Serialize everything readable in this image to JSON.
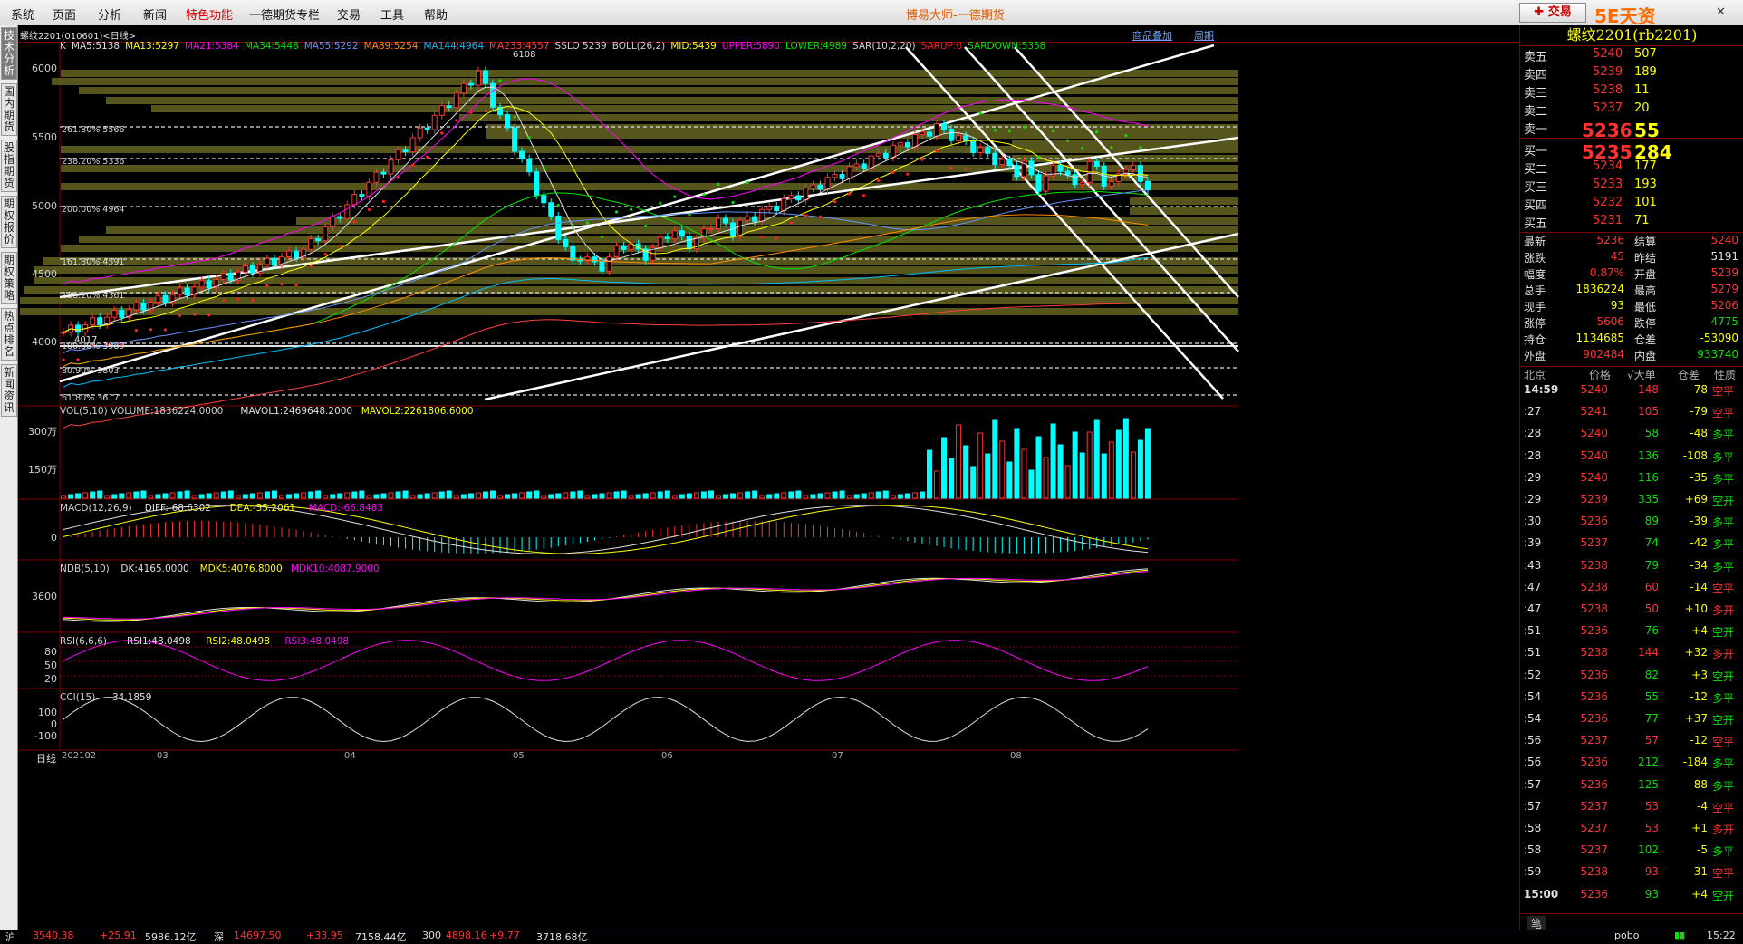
{
  "menu": {
    "items": [
      "系统",
      "页面",
      "分析",
      "新闻",
      "特色功能",
      "一德期货专栏",
      "交易",
      "工具",
      "帮助"
    ],
    "highlight": "特色功能",
    "app_title": "博易大师-一德期货",
    "trade_button": "交易",
    "watermark": "5E天资5etz.com"
  },
  "left_tabs": [
    "技术分析",
    "国内期货",
    "股指期货",
    "期权报价",
    "期权策略",
    "热点排名",
    "新闻资讯"
  ],
  "chart": {
    "header": {
      "symbol": "螺纹2201(010601)<日线>",
      "overlay_link": "商品叠加",
      "period_link": "周期"
    },
    "main_indicators": [
      {
        "text": "K",
        "color": "#d0d0d0"
      },
      {
        "text": "MA5:5138",
        "color": "#e0e0e0"
      },
      {
        "text": "MA13:5297",
        "color": "#ffff00"
      },
      {
        "text": "MA21:5384",
        "color": "#ff00ff"
      },
      {
        "text": "MA34:5448",
        "color": "#00e600"
      },
      {
        "text": "MA55:5292",
        "color": "#6495ff"
      },
      {
        "text": "MA89:5254",
        "color": "#ff8c00"
      },
      {
        "text": "MA144:4964",
        "color": "#00bfff"
      },
      {
        "text": "MA233:4557",
        "color": "#ff4040"
      },
      {
        "text": "SSLO 5239",
        "color": "#d0d0d0"
      },
      {
        "text": "BOLL(26,2)",
        "color": "#d0d0d0"
      },
      {
        "text": "MID:5439",
        "color": "#ffff00"
      },
      {
        "text": "UPPER:5890",
        "color": "#ff00ff"
      },
      {
        "text": "LOWER:4989",
        "color": "#00e600"
      },
      {
        "text": "SAR(10,2,20)",
        "color": "#d0d0d0"
      },
      {
        "text": "SARUP:0",
        "color": "#ff2020"
      },
      {
        "text": "SARDOWN:5358",
        "color": "#00e600"
      }
    ],
    "price_axis": [
      "6000",
      "5500",
      "5000",
      "4500",
      "4000"
    ],
    "fib_levels": [
      "261.80% 5566",
      "238.20% 5336",
      "200.00% 4964",
      "161.80% 4591",
      "138.20% 4361",
      "100.00% 3989",
      "80.90% 3803",
      "61.80% 3617"
    ],
    "marks": {
      "high": "6108",
      "low": "4017"
    },
    "vol": {
      "label": "VOL(5,10) VOLUME:1836224.0000",
      "mavol1": "MAVOL1:2469648.2000",
      "mavol2": "MAVOL2:2261806.6000",
      "axis": [
        "300万",
        "150万"
      ]
    },
    "macd": {
      "label": "MACD(12,26,9)",
      "diff": "DIFF:-68.6302",
      "dea": "DEA:-35.2061",
      "macd": "MACD:-66.8483",
      "axis": [
        "0"
      ]
    },
    "ndb": {
      "label": "NDB(5,10)",
      "dk": "DK:4165.0000",
      "mdk5": "MDK5:4076.8000",
      "mdk10": "MDK10:4087.9000",
      "axis": [
        "3600"
      ]
    },
    "rsi": {
      "label": "RSI(6,6,6)",
      "rsi1": "RSI1:48.0498",
      "rsi2": "RSI2:48.0498",
      "rsi3": "RSI3:48.0498",
      "axis": [
        "80",
        "50",
        "20"
      ]
    },
    "cci": {
      "label": "CCI(15)",
      "value": "-34.1859",
      "axis": [
        "100",
        "0",
        "-100"
      ]
    },
    "date_axis": {
      "label": "日线",
      "dates": [
        "202102",
        "03",
        "04",
        "05",
        "06",
        "07",
        "08"
      ]
    }
  },
  "quote": {
    "title": "螺纹2201(rb2201)",
    "asks": [
      {
        "label": "卖五",
        "price": "5240",
        "vol": "507"
      },
      {
        "label": "卖四",
        "price": "5239",
        "vol": "189"
      },
      {
        "label": "卖三",
        "price": "5238",
        "vol": "11"
      },
      {
        "label": "卖二",
        "price": "5237",
        "vol": "20"
      },
      {
        "label": "卖一",
        "price": "5236",
        "vol": "55"
      }
    ],
    "bids": [
      {
        "label": "买一",
        "price": "5235",
        "vol": "284"
      },
      {
        "label": "买二",
        "price": "5234",
        "vol": "177"
      },
      {
        "label": "买三",
        "price": "5233",
        "vol": "193"
      },
      {
        "label": "买四",
        "price": "5232",
        "vol": "101"
      },
      {
        "label": "买五",
        "price": "5231",
        "vol": "71"
      }
    ],
    "stats": [
      {
        "l1": "最新",
        "v1": "5236",
        "c1": "red",
        "l2": "结算",
        "v2": "5240",
        "c2": "red"
      },
      {
        "l1": "涨跌",
        "v1": "45",
        "c1": "red",
        "l2": "昨结",
        "v2": "5191",
        "c2": "wht"
      },
      {
        "l1": "幅度",
        "v1": "0.87%",
        "c1": "red",
        "l2": "开盘",
        "v2": "5239",
        "c2": "red"
      },
      {
        "l1": "总手",
        "v1": "1836224",
        "c1": "yel",
        "l2": "最高",
        "v2": "5279",
        "c2": "red"
      },
      {
        "l1": "现手",
        "v1": "93",
        "c1": "yel",
        "l2": "最低",
        "v2": "5206",
        "c2": "red"
      },
      {
        "l1": "涨停",
        "v1": "5606",
        "c1": "red",
        "l2": "跌停",
        "v2": "4775",
        "c2": "grn"
      },
      {
        "l1": "持仓",
        "v1": "1134685",
        "c1": "yel",
        "l2": "仓差",
        "v2": "-53090",
        "c2": "yel"
      },
      {
        "l1": "外盘",
        "v1": "902484",
        "c1": "red",
        "l2": "内盘",
        "v2": "933740",
        "c2": "grn"
      }
    ],
    "tick_header": {
      "loc": "北京",
      "price": "价格",
      "big": "√大单",
      "oi": "仓差",
      "nature": "性质"
    },
    "ticks": [
      {
        "t": "14:59",
        "p": "5240",
        "v": "148",
        "oi": "-78",
        "n": "空平",
        "nc": "red"
      },
      {
        "t": ":27",
        "p": "5241",
        "v": "105",
        "oi": "-79",
        "n": "空平",
        "nc": "red"
      },
      {
        "t": ":28",
        "p": "5240",
        "v": "58",
        "oi": "-48",
        "n": "多平",
        "nc": "grn"
      },
      {
        "t": ":28",
        "p": "5240",
        "v": "136",
        "oi": "-108",
        "n": "多平",
        "nc": "grn"
      },
      {
        "t": ":29",
        "p": "5240",
        "v": "116",
        "oi": "-35",
        "n": "多平",
        "nc": "grn"
      },
      {
        "t": ":29",
        "p": "5239",
        "v": "335",
        "oi": "+69",
        "n": "空开",
        "nc": "grn"
      },
      {
        "t": ":30",
        "p": "5236",
        "v": "89",
        "oi": "-39",
        "n": "多平",
        "nc": "grn"
      },
      {
        "t": ":39",
        "p": "5237",
        "v": "74",
        "oi": "-42",
        "n": "多平",
        "nc": "grn"
      },
      {
        "t": ":43",
        "p": "5238",
        "v": "79",
        "oi": "-34",
        "n": "多平",
        "nc": "grn"
      },
      {
        "t": ":47",
        "p": "5238",
        "v": "60",
        "oi": "-14",
        "n": "空平",
        "nc": "red"
      },
      {
        "t": ":47",
        "p": "5238",
        "v": "50",
        "oi": "+10",
        "n": "多开",
        "nc": "red"
      },
      {
        "t": ":51",
        "p": "5236",
        "v": "76",
        "oi": "+4",
        "n": "空开",
        "nc": "grn"
      },
      {
        "t": ":51",
        "p": "5238",
        "v": "144",
        "oi": "+32",
        "n": "多开",
        "nc": "red"
      },
      {
        "t": ":52",
        "p": "5236",
        "v": "82",
        "oi": "+3",
        "n": "空开",
        "nc": "grn"
      },
      {
        "t": ":54",
        "p": "5236",
        "v": "55",
        "oi": "-12",
        "n": "多平",
        "nc": "grn"
      },
      {
        "t": ":54",
        "p": "5236",
        "v": "77",
        "oi": "+37",
        "n": "空开",
        "nc": "grn"
      },
      {
        "t": ":56",
        "p": "5237",
        "v": "57",
        "oi": "-12",
        "n": "空平",
        "nc": "red"
      },
      {
        "t": ":56",
        "p": "5236",
        "v": "212",
        "oi": "-184",
        "n": "多平",
        "nc": "grn"
      },
      {
        "t": ":57",
        "p": "5236",
        "v": "125",
        "oi": "-88",
        "n": "多平",
        "nc": "grn"
      },
      {
        "t": ":57",
        "p": "5237",
        "v": "53",
        "oi": "-4",
        "n": "空平",
        "nc": "red"
      },
      {
        "t": ":58",
        "p": "5237",
        "v": "53",
        "oi": "+1",
        "n": "多开",
        "nc": "red"
      },
      {
        "t": ":58",
        "p": "5237",
        "v": "102",
        "oi": "-5",
        "n": "多平",
        "nc": "grn"
      },
      {
        "t": ":59",
        "p": "5238",
        "v": "93",
        "oi": "-31",
        "n": "空平",
        "nc": "red"
      },
      {
        "t": "15:00",
        "p": "5236",
        "v": "93",
        "oi": "+4",
        "n": "空开",
        "nc": "grn"
      }
    ],
    "bottom_tab": "笔"
  },
  "status": {
    "items": [
      {
        "text": "沪",
        "c": "wht"
      },
      {
        "text": "3540.38",
        "c": "red"
      },
      {
        "text": "+25.91",
        "c": "red"
      },
      {
        "text": "5986.12亿",
        "c": "wht"
      },
      {
        "text": "深",
        "c": "wht"
      },
      {
        "text": "14697.50",
        "c": "red"
      },
      {
        "text": "+33.95",
        "c": "red"
      },
      {
        "text": "7158.44亿",
        "c": "wht"
      },
      {
        "text": "300",
        "c": "wht"
      },
      {
        "text": "4898.16",
        "c": "red"
      },
      {
        "text": "+9.77",
        "c": "red"
      },
      {
        "text": "3718.68亿",
        "c": "wht"
      }
    ],
    "brand": "pobo",
    "time": "15:22"
  },
  "colors": {
    "up": "#ff3232",
    "down": "#00ffff",
    "bg": "#000000",
    "grid": "#800000",
    "fib": "#ffffff",
    "vp": "#5a5a1e"
  }
}
